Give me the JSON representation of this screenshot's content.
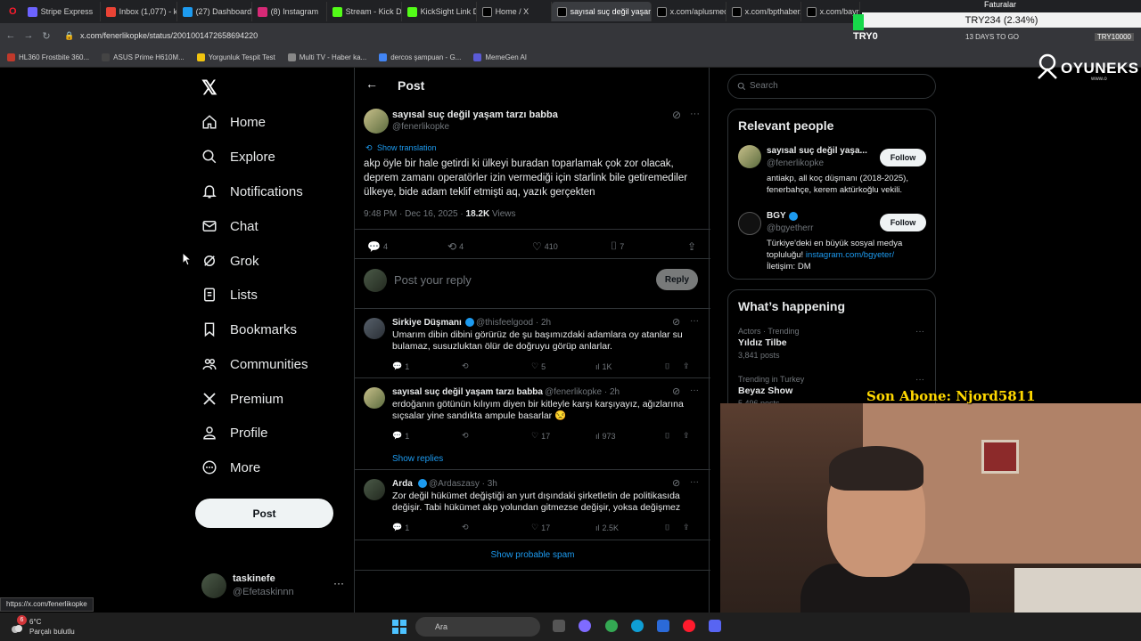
{
  "browser": {
    "tabs": [
      {
        "label": "Stripe Express",
        "color": "#6c63ff"
      },
      {
        "label": "Inbox (1,077) - kick",
        "color": "#ea4335"
      },
      {
        "label": "(27) Dashboard / ...",
        "color": "#1d9bf0"
      },
      {
        "label": "(8) Instagram",
        "color": "#d62976"
      },
      {
        "label": "Stream - Kick Da...",
        "color": "#53fc18"
      },
      {
        "label": "KickSight Link De...",
        "color": "#53fc18"
      },
      {
        "label": "Home / X",
        "color": "#000000"
      },
      {
        "label": "sayısal suç değil yaşam ta...",
        "color": "#000000"
      },
      {
        "label": "x.com/aplusmedy...",
        "color": "#000000"
      },
      {
        "label": "x.com/bpthaber/...",
        "color": "#000000"
      },
      {
        "label": "x.com/bayrakme...",
        "color": "#000000"
      }
    ],
    "url": "x.com/fenerlikopke/status/2001001472658694220",
    "bookmarks": [
      {
        "label": "HL360 Frostbite 360...",
        "color": "#c0392b"
      },
      {
        "label": "ASUS Prime H610M...",
        "color": "#444444"
      },
      {
        "label": "Yorgunluk Tespit Test",
        "color": "#f1c40f"
      },
      {
        "label": "Multi TV - Haber ka...",
        "color": "#888888"
      },
      {
        "label": "dercos şampuan - G...",
        "color": "#4285f4"
      },
      {
        "label": "MemeGen AI",
        "color": "#5b5bd6"
      }
    ],
    "status_url": "https://x.com/fenerlikopke"
  },
  "overlay": {
    "faturalar": "Faturalar",
    "ticker": "TRY234 (2.34%)",
    "try0": "TRY0",
    "days": "13 DAYS TO GO",
    "try_goal": "TRY10000",
    "oyuneks": "OYUNEKS",
    "oyuneks_sub": "www.o",
    "son_abone": "Son Abone: Njord5811"
  },
  "sidebar": {
    "items": [
      {
        "label": "Home",
        "icon": "home-icon"
      },
      {
        "label": "Explore",
        "icon": "search-icon"
      },
      {
        "label": "Notifications",
        "icon": "bell-icon"
      },
      {
        "label": "Chat",
        "icon": "mail-icon"
      },
      {
        "label": "Grok",
        "icon": "grok-icon"
      },
      {
        "label": "Lists",
        "icon": "list-icon"
      },
      {
        "label": "Bookmarks",
        "icon": "bookmark-icon"
      },
      {
        "label": "Communities",
        "icon": "people-icon"
      },
      {
        "label": "Premium",
        "icon": "x-icon"
      },
      {
        "label": "Profile",
        "icon": "person-icon"
      },
      {
        "label": "More",
        "icon": "more-icon"
      }
    ],
    "post_button": "Post",
    "account": {
      "name": "taskinefe",
      "handle": "@Efetaskinnn"
    }
  },
  "main": {
    "title": "Post",
    "tweet": {
      "name": "sayısal suç değil yaşam tarzı babba",
      "handle": "@fenerlikopke",
      "show_translation": "Show translation",
      "text": "akp öyle bir hale getirdi ki ülkeyi buradan toparlamak çok zor olacak, deprem zamanı operatörler izin vermediği için starlink bile getiremediler ülkeye, bide adam teklif etmişti aq, yazık gerçekten",
      "time": "9:48 PM · Dec 16, 2025 · ",
      "views": "18.2K",
      "views_label": " Views",
      "replies": "4",
      "reposts": "4",
      "likes": "410",
      "bookmarks": "7"
    },
    "reply_placeholder": "Post your reply",
    "reply_button": "Reply",
    "replies": [
      {
        "name": "Sirkiye Düşmanı",
        "handle": "@thisfeelgood · 2h",
        "text": "Umarım dibin dibini görürüz de şu başımızdaki adamlara oy atanlar su bulamaz, susuzluktan ölür de doğruyu görüp anlarlar.",
        "replies": "1",
        "reposts": "",
        "likes": "5",
        "views": "1K"
      },
      {
        "name": "sayısal suç değil yaşam tarzı babba",
        "handle": "@fenerlikopke · 2h",
        "text": "erdoğanın götünün kılıyım diyen bir kitleyle karşı karşıyayız, ağızlarına sıçsalar yine sandıkta ampule basarlar 😒",
        "replies": "1",
        "reposts": "",
        "likes": "17",
        "views": "973"
      },
      {
        "name": "Arda",
        "handle": "@Ardaszasy · 3h",
        "text": "Zor değil hükümet değiştiği an yurt dışındaki şirketletin de politikasıda değişir. Tabi hükümet akp yolundan gitmezse değişir, yoksa değişmez",
        "replies": "1",
        "reposts": "",
        "likes": "17",
        "views": "2.5K"
      }
    ],
    "show_replies": "Show replies",
    "show_spam": "Show probable spam"
  },
  "right": {
    "search_placeholder": "Search",
    "relevant_title": "Relevant people",
    "people": [
      {
        "name": "sayısal suç değil yaşa...",
        "handle": "@fenerlikopke",
        "bio": "antiakp, all koç düşmanı (2018-2025), fenerbahçe, kerem aktürkoğlu vekili.",
        "follow": "Follow"
      },
      {
        "name": "BGY",
        "handle": "@bgyetherr",
        "bio": "Türkiye'deki en büyük sosyal medya topluluğu! ",
        "link": "instagram.com/bgyeter/",
        "bio2": "İletişim: DM",
        "follow": "Follow"
      }
    ],
    "happening_title": "What’s happening",
    "trends": [
      {
        "context": "Actors · Trending",
        "name": "Yıldız Tilbe",
        "posts": "3,841 posts"
      },
      {
        "context": "Trending in Turkey",
        "name": "Beyaz Show",
        "posts": "5,496 posts"
      }
    ]
  },
  "taskbar": {
    "weather_badge": "6",
    "temp": "6°C",
    "condition": "Parçalı bulutlu",
    "search": "Ara"
  }
}
